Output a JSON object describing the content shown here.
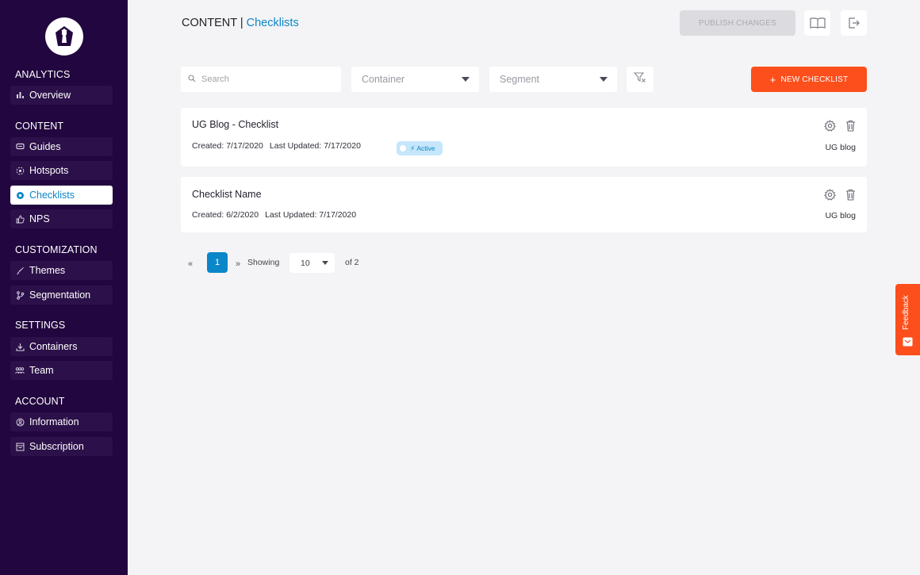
{
  "sidebar": {
    "sections": [
      {
        "title": "ANALYTICS",
        "items": [
          {
            "label": "Overview",
            "icon": "bar-chart-icon"
          }
        ]
      },
      {
        "title": "CONTENT",
        "items": [
          {
            "label": "Guides",
            "icon": "guides-icon"
          },
          {
            "label": "Hotspots",
            "icon": "hotspot-icon"
          },
          {
            "label": "Checklists",
            "icon": "checklist-icon",
            "active": true
          },
          {
            "label": "NPS",
            "icon": "thumbs-up-icon"
          }
        ]
      },
      {
        "title": "CUSTOMIZATION",
        "items": [
          {
            "label": "Themes",
            "icon": "brush-icon"
          },
          {
            "label": "Segmentation",
            "icon": "branch-icon"
          }
        ]
      },
      {
        "title": "SETTINGS",
        "items": [
          {
            "label": "Containers",
            "icon": "download-icon"
          },
          {
            "label": "Team",
            "icon": "team-icon"
          }
        ]
      },
      {
        "title": "ACCOUNT",
        "items": [
          {
            "label": "Information",
            "icon": "user-circle-icon"
          },
          {
            "label": "Subscription",
            "icon": "subscription-icon"
          }
        ]
      }
    ]
  },
  "header": {
    "crumb_section": "CONTENT |",
    "crumb_page": "Checklists",
    "publish_label": "PUBLISH CHANGES"
  },
  "filters": {
    "search_placeholder": "Search",
    "container_label": "Container",
    "segment_label": "Segment",
    "new_label": "NEW CHECKLIST"
  },
  "checklists": [
    {
      "name": "UG Blog - Checklist",
      "created": "Created: 7/17/2020",
      "updated": "Last Updated: 7/17/2020",
      "status": "Active",
      "container": "UG blog"
    },
    {
      "name": "Checklist Name",
      "created": "Created: 6/2/2020",
      "updated": "Last Updated: 7/17/2020",
      "status": "",
      "container": "UG blog"
    }
  ],
  "pagination": {
    "prev": "«",
    "current": "1",
    "next": "»",
    "showing_label": "Showing",
    "page_size": "10",
    "of_label": "of 2"
  },
  "feedback": {
    "label": "Feedback"
  },
  "colors": {
    "sidebar": "#22063f",
    "accent": "#0b86c8",
    "primary_button": "#fc4f1c"
  }
}
